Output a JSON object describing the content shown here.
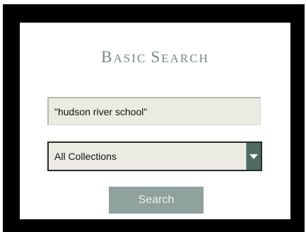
{
  "form": {
    "title_big_b": "B",
    "title_rest_1": "ASIC ",
    "title_big_s": "S",
    "title_rest_2": "EARCH",
    "query_value": "\"hudson river school\"",
    "collection_selected": "All Collections",
    "search_label": "Search"
  },
  "colors": {
    "frame": "#000000",
    "field_bg": "#ecebe3",
    "accent": "#4f6963",
    "button": "#8fa29d",
    "title": "#7a8785"
  },
  "icons": {
    "dropdown": "chevron-down-icon"
  }
}
